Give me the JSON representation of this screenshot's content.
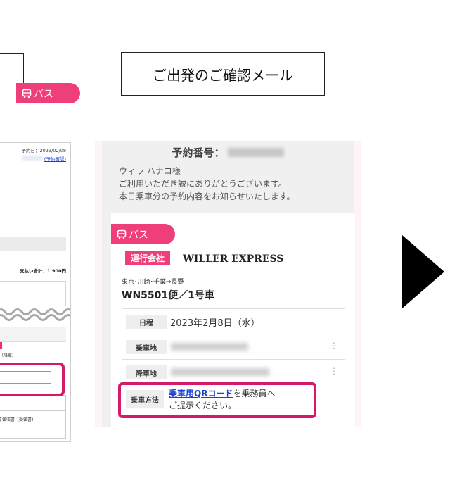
{
  "left_panel": {
    "date_text": "予約日：2023/02/08",
    "link_text": "(予約確認)",
    "total_text": "支払い合計：1,900円",
    "badge_text": "る",
    "drop_text": "（降車）",
    "receipt_text": "る領収書（受領書)"
  },
  "email_title": "ご出発のご確認メール",
  "email": {
    "reservation_label": "予約番号：",
    "greeting": [
      "ウィラ ハナコ様",
      "ご利用いただき誠にありがとうございます。",
      "本日乗車分の予約内容をお知らせいたします。"
    ],
    "bus_tab_label": "バス",
    "operator_badge": "運行会社",
    "operator_name": "WILLER EXPRESS",
    "route": "東京･川崎･千葉⇒長野",
    "flight": "WN5501便／1号車",
    "rows": [
      {
        "label": "日程",
        "value": "2023年2月8日（水）"
      },
      {
        "label": "乗車地",
        "value": ""
      },
      {
        "label": "降車地",
        "value": ""
      }
    ],
    "method": {
      "label": "乗車方法",
      "link_text": "乗車用QRコード",
      "after_link": "を乗務員へ",
      "line2": "ご提示ください。"
    }
  },
  "colors": {
    "accent_pink": "#ee3f7a",
    "highlight": "#d6196a",
    "link_blue": "#1a3fd1"
  }
}
